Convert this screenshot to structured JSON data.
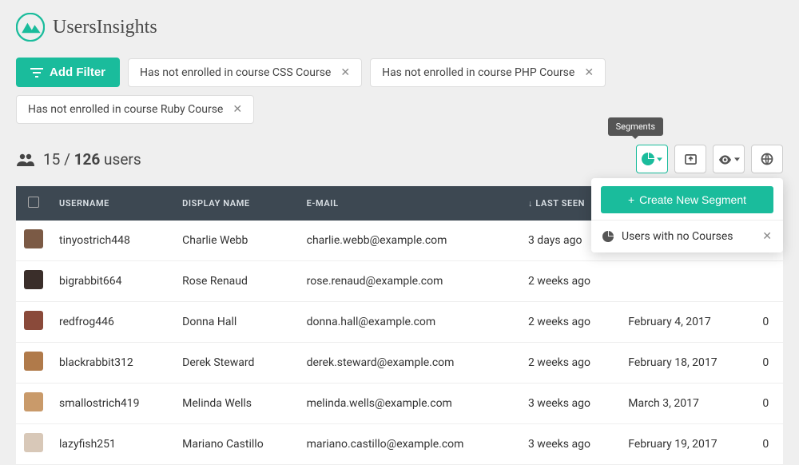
{
  "brand": "UsersInsights",
  "add_filter_label": "Add Filter",
  "filters": [
    "Has not enrolled in course CSS Course",
    "Has not enrolled in course PHP Course",
    "Has not enrolled in course Ruby Course"
  ],
  "stats": {
    "shown": "15",
    "total": "126",
    "suffix": "users"
  },
  "tooltip_segments": "Segments",
  "segments_dropdown": {
    "create_label": "Create New Segment",
    "items": [
      "Users with no Courses"
    ]
  },
  "columns": {
    "username": "USERNAME",
    "display_name": "DISPLAY NAME",
    "email": "E-MAIL",
    "last_seen": "LAST SEEN"
  },
  "rows": [
    {
      "avatar": "#7b5a45",
      "username": "tinyostrich448",
      "display_name": "Charlie Webb",
      "email": "charlie.webb@example.com",
      "last_seen": "3 days ago",
      "date": "",
      "count": ""
    },
    {
      "avatar": "#3a2e2a",
      "username": "bigrabbit664",
      "display_name": "Rose Renaud",
      "email": "rose.renaud@example.com",
      "last_seen": "2 weeks ago",
      "date": "",
      "count": ""
    },
    {
      "avatar": "#8a4a3a",
      "username": "redfrog446",
      "display_name": "Donna Hall",
      "email": "donna.hall@example.com",
      "last_seen": "2 weeks ago",
      "date": "February 4, 2017",
      "count": "0"
    },
    {
      "avatar": "#b07a4a",
      "username": "blackrabbit312",
      "display_name": "Derek Steward",
      "email": "derek.steward@example.com",
      "last_seen": "2 weeks ago",
      "date": "February 18, 2017",
      "count": "0"
    },
    {
      "avatar": "#c99a6a",
      "username": "smallostrich419",
      "display_name": "Melinda Wells",
      "email": "melinda.wells@example.com",
      "last_seen": "3 weeks ago",
      "date": "March 3, 2017",
      "count": "0"
    },
    {
      "avatar": "#d8c8b8",
      "username": "lazyfish251",
      "display_name": "Mariano Castillo",
      "email": "mariano.castillo@example.com",
      "last_seen": "3 weeks ago",
      "date": "February 19, 2017",
      "count": "0"
    }
  ]
}
